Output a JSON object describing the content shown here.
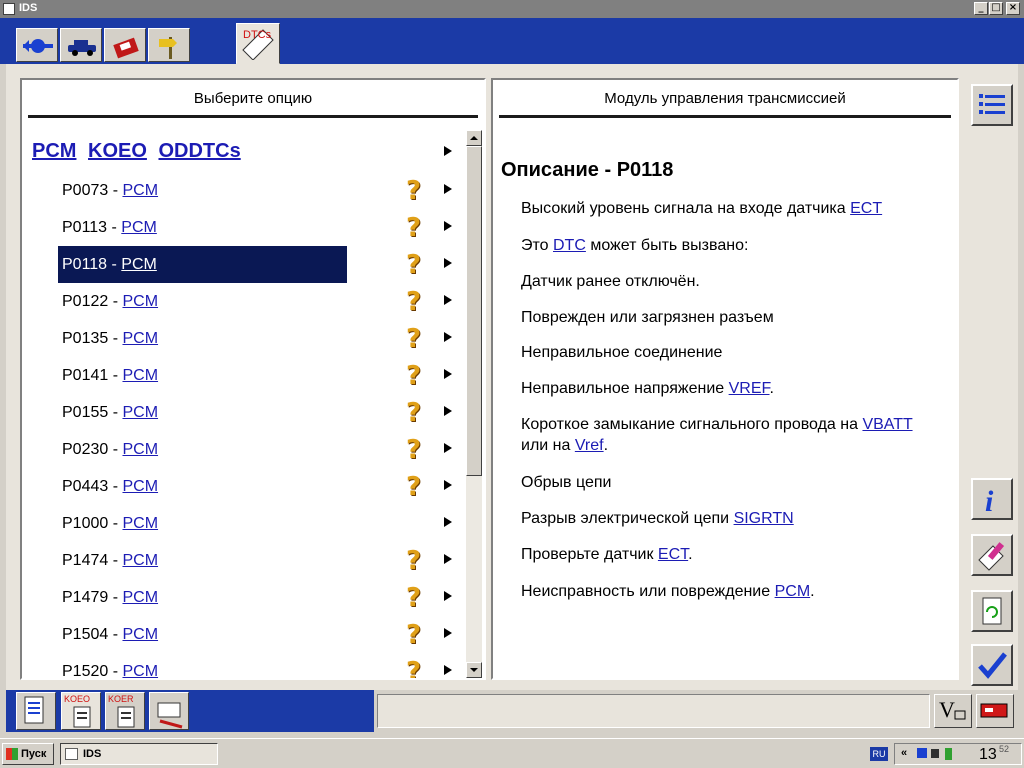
{
  "window": {
    "title": "IDS",
    "minimize": "_",
    "maximize": "□",
    "close": "×"
  },
  "toolbar": {
    "dtc_tab_label": "DTCs"
  },
  "left_panel": {
    "header": "Выберите опцию",
    "list_header": {
      "part1": "PCM",
      "part2": "KOEO",
      "part3": "ODDTCs"
    },
    "rows": [
      {
        "code": "P0073",
        "sep": " - ",
        "module": "PCM",
        "has_help": true
      },
      {
        "code": "P0113",
        "sep": " - ",
        "module": "PCM",
        "has_help": true
      },
      {
        "code": "P0118",
        "sep": " - ",
        "module": "PCM",
        "has_help": true,
        "selected": true
      },
      {
        "code": "P0122",
        "sep": " - ",
        "module": "PCM",
        "has_help": true
      },
      {
        "code": "P0135",
        "sep": " - ",
        "module": "PCM",
        "has_help": true
      },
      {
        "code": "P0141",
        "sep": " - ",
        "module": "PCM",
        "has_help": true
      },
      {
        "code": "P0155",
        "sep": " - ",
        "module": "PCM",
        "has_help": true
      },
      {
        "code": "P0230",
        "sep": " - ",
        "module": "PCM",
        "has_help": true
      },
      {
        "code": "P0443",
        "sep": " - ",
        "module": "PCM",
        "has_help": true
      },
      {
        "code": "P1000",
        "sep": " - ",
        "module": "PCM",
        "has_help": false
      },
      {
        "code": "P1474",
        "sep": " - ",
        "module": "PCM",
        "has_help": true
      },
      {
        "code": "P1479",
        "sep": " - ",
        "module": "PCM",
        "has_help": true
      },
      {
        "code": "P1504",
        "sep": " - ",
        "module": "PCM",
        "has_help": true
      },
      {
        "code": "P1520",
        "sep": " - ",
        "module": "PCM",
        "has_help": true
      }
    ]
  },
  "right_panel": {
    "header": "Модуль управления трансмиссией",
    "title": "Описание - P0118",
    "items": [
      {
        "t1": "Высокий уровень сигнала на входе датчика ",
        "l1": "ECT",
        "t2": ""
      },
      {
        "t1": "Это ",
        "l1": "DTC",
        "t2": " может быть вызвано:"
      },
      {
        "t1": "Датчик ранее отключён.",
        "l1": "",
        "t2": ""
      },
      {
        "t1": "Поврежден или загрязнен разъем",
        "l1": "",
        "t2": ""
      },
      {
        "t1": "Неправильное соединение",
        "l1": "",
        "t2": ""
      },
      {
        "t1": "Неправильное напряжение ",
        "l1": "VREF",
        "t2": "."
      },
      {
        "t1": "Короткое замыкание сигнального провода на ",
        "l1": "VBATT",
        "t2": " или на ",
        "l2": "Vref",
        "t3": "."
      },
      {
        "t1": "Обрыв цепи",
        "l1": "",
        "t2": ""
      },
      {
        "t1": "Разрыв электрической цепи ",
        "l1": "SIGRTN",
        "t2": ""
      },
      {
        "t1": "Проверьте датчик ",
        "l1": "ECT",
        "t2": "."
      },
      {
        "t1": "Неисправность или повреждение ",
        "l1": "PCM",
        "t2": "."
      }
    ]
  },
  "bottom": {
    "koeo_label": "KOEO",
    "koer_label": "KOER"
  },
  "taskbar": {
    "start_label": "Пуск",
    "task_label": "IDS",
    "lang": "RU",
    "tray_chevron": "«",
    "clock": "13",
    "clock_small": "52"
  },
  "colors": {
    "toolbar_blue": "#1b3aa6",
    "selection": "#0a1854",
    "link": "#1c1cb4",
    "help_icon": "#e0a018"
  }
}
